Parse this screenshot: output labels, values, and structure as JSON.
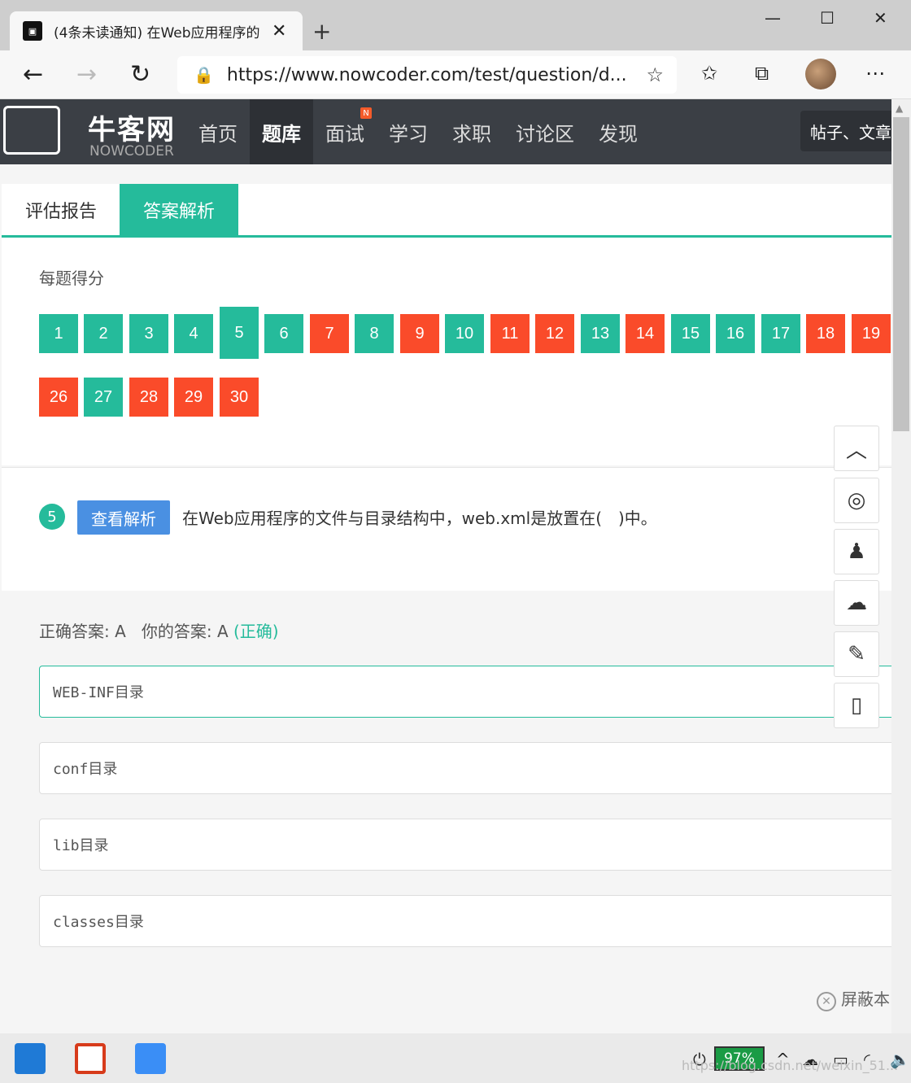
{
  "browser": {
    "tab_title": "(4条未读通知) 在Web应用程序的",
    "url": "https://www.nowcoder.com/test/question/d..."
  },
  "site": {
    "logo": "牛客网",
    "logo_sub": "NOWCODER",
    "nav": [
      "首页",
      "题库",
      "面试",
      "学习",
      "求职",
      "讨论区",
      "发现"
    ],
    "active_nav": "题库",
    "badge": "N",
    "search_placeholder": "帖子、文章"
  },
  "tabs": [
    "评估报告",
    "答案解析"
  ],
  "score_title": "每题得分",
  "questions": [
    {
      "n": "1",
      "s": "ok"
    },
    {
      "n": "2",
      "s": "ok"
    },
    {
      "n": "3",
      "s": "ok"
    },
    {
      "n": "4",
      "s": "ok"
    },
    {
      "n": "5",
      "s": "ok",
      "current": true
    },
    {
      "n": "6",
      "s": "ok"
    },
    {
      "n": "7",
      "s": "bad"
    },
    {
      "n": "8",
      "s": "ok"
    },
    {
      "n": "9",
      "s": "bad"
    },
    {
      "n": "10",
      "s": "ok"
    },
    {
      "n": "11",
      "s": "bad"
    },
    {
      "n": "12",
      "s": "bad"
    },
    {
      "n": "13",
      "s": "ok"
    },
    {
      "n": "14",
      "s": "bad"
    },
    {
      "n": "15",
      "s": "ok"
    },
    {
      "n": "16",
      "s": "ok"
    },
    {
      "n": "17",
      "s": "ok"
    },
    {
      "n": "18",
      "s": "bad"
    },
    {
      "n": "19",
      "s": "bad"
    },
    {
      "n": "26",
      "s": "bad"
    },
    {
      "n": "27",
      "s": "ok"
    },
    {
      "n": "28",
      "s": "bad"
    },
    {
      "n": "29",
      "s": "bad"
    },
    {
      "n": "30",
      "s": "bad"
    }
  ],
  "question": {
    "number": "5",
    "button": "查看解析",
    "text": "在Web应用程序的文件与目录结构中，web.xml是放置在(　)中。"
  },
  "answer": {
    "correct_label": "正确答案: A",
    "yours_label": "你的答案: A",
    "result": "(正确)"
  },
  "options": [
    "WEB-INF目录",
    "conf目录",
    "lib目录",
    "classes目录"
  ],
  "shield_text": "屏蔽本",
  "taskbar": {
    "battery": "97%",
    "watermark": "https://blog.csdn.net/weixin_51..."
  }
}
